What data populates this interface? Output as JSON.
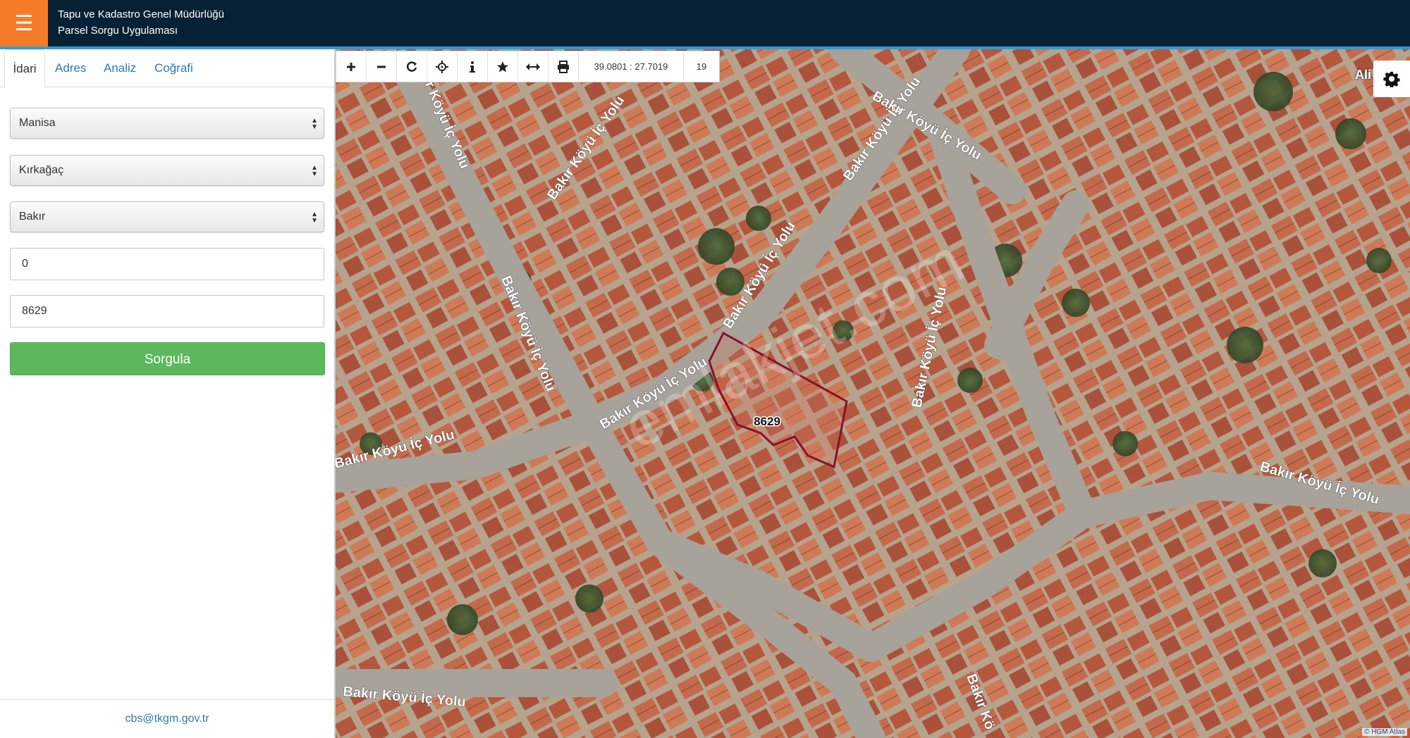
{
  "header": {
    "menu_icon": "hamburger-icon",
    "title_line1": "Tapu ve Kadastro Genel Müdürlüğü",
    "title_line2": "Parsel Sorgu Uygulaması"
  },
  "sidebar": {
    "tabs": [
      {
        "label": "İdari",
        "active": true
      },
      {
        "label": "Adres",
        "active": false
      },
      {
        "label": "Analiz",
        "active": false
      },
      {
        "label": "Coğrafi",
        "active": false
      }
    ],
    "province": "Manisa",
    "district": "Kırkağaç",
    "neighborhood": "Bakır",
    "block_no": "0",
    "parcel_no": "8629",
    "submit_label": "Sorgula",
    "footer_email": "cbs@tkgm.gov.tr"
  },
  "toolbar": {
    "tools": [
      "zoom-in-icon",
      "zoom-out-icon",
      "refresh-icon",
      "locate-icon",
      "info-icon",
      "favorite-icon",
      "measure-icon",
      "print-icon"
    ],
    "coordinates": "39.0801 : 27.7019",
    "zoom_level": "19"
  },
  "map": {
    "parcel_label": "8629",
    "road_label": "Bakır Köyü İç Yolu",
    "corner_label": "Ali",
    "corner_label_bottom": "Bakır Kö",
    "attribution": "© HGM Atlas",
    "watermark": "emlakjet.com",
    "parcel_color": "#8a1028"
  },
  "colors": {
    "header_bg": "#062133",
    "menu_bg": "#f47c28",
    "submit_bg": "#5cb85c",
    "link": "#2a7ab7"
  }
}
